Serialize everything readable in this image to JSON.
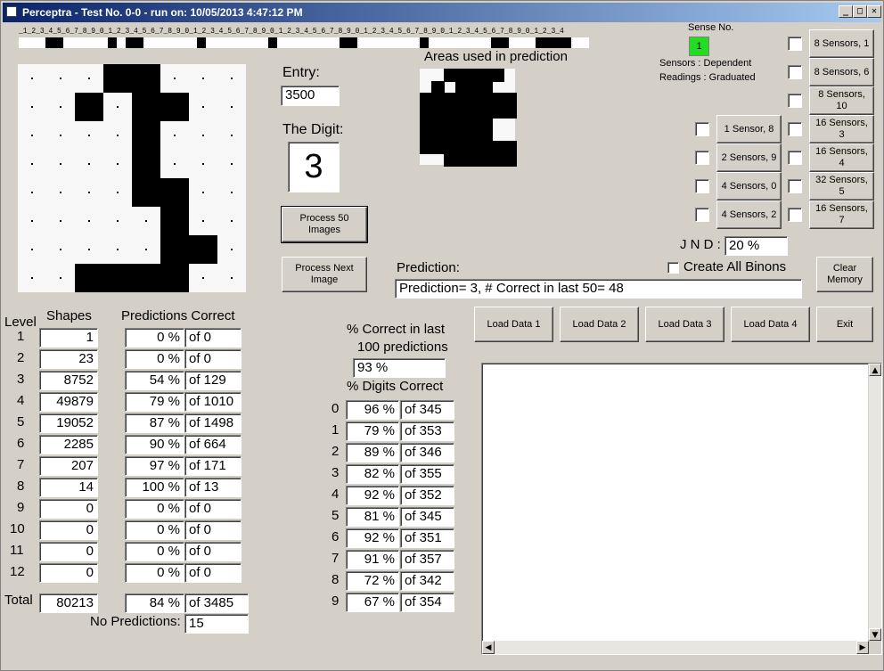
{
  "window": {
    "title": "Perceptra - Test No. 0-0 - run on: 10/05/2013  4:47:12 PM"
  },
  "digit_ruler": {
    "text": "_1_2_3_4_5_6_7_8_9_0_1_2_3_4_5_6_7_8_9_0_1_2_3_4_5_6_7_8_9_0_1_2_3_4_5_6_7_8_9_0_1_2_3_4_5_6_7_8_9_0_1_2_3_4_5_6_7_8_9_0_1_2_3_4"
  },
  "entry": {
    "label": "Entry:",
    "value": "3500"
  },
  "digit": {
    "label": "The Digit:",
    "value": "3"
  },
  "areas_label": "Areas used in prediction",
  "buttons": {
    "process50": "Process 50 Images",
    "process_next": "Process Next Image",
    "clear_memory": "Clear Memory",
    "load1": "Load Data 1",
    "load2": "Load Data 2",
    "load3": "Load Data 3",
    "load4": "Load Data 4",
    "exit": "Exit"
  },
  "sense": {
    "label": "Sense No.",
    "value": "1",
    "sensors_text": "Sensors  :  Dependent",
    "readings_text": "Readings : Graduated"
  },
  "sensor_buttons_right": [
    "8 Sensors, 1",
    "8 Sensors, 6",
    "8 Sensors, 10",
    "16 Sensors, 3",
    "16 Sensors, 4",
    "32 Sensors, 5",
    "16 Sensors, 7"
  ],
  "sensor_buttons_left": [
    "1 Sensor, 8",
    "2 Sensors, 9",
    "4 Sensors, 0",
    "4 Sensors, 2"
  ],
  "jnd": {
    "label": "J N D :",
    "value": "20 %"
  },
  "create_all_binons": "Create All Binons",
  "prediction": {
    "label": "Prediction:",
    "value": "Prediction= 3, # Correct in last 50= 48"
  },
  "levels_table": {
    "headers": {
      "level": "Level",
      "shapes": "Shapes",
      "predictions": "Predictions Correct"
    },
    "rows": [
      {
        "level": "1",
        "shapes": "1",
        "pct": "0 %",
        "of": "of 0"
      },
      {
        "level": "2",
        "shapes": "23",
        "pct": "0 %",
        "of": "of 0"
      },
      {
        "level": "3",
        "shapes": "8752",
        "pct": "54 %",
        "of": "of 129"
      },
      {
        "level": "4",
        "shapes": "49879",
        "pct": "79 %",
        "of": "of 1010"
      },
      {
        "level": "5",
        "shapes": "19052",
        "pct": "87 %",
        "of": "of 1498"
      },
      {
        "level": "6",
        "shapes": "2285",
        "pct": "90 %",
        "of": "of 664"
      },
      {
        "level": "7",
        "shapes": "207",
        "pct": "97 %",
        "of": "of 171"
      },
      {
        "level": "8",
        "shapes": "14",
        "pct": "100 %",
        "of": "of 13"
      },
      {
        "level": "9",
        "shapes": "0",
        "pct": "0 %",
        "of": "of 0"
      },
      {
        "level": "10",
        "shapes": "0",
        "pct": "0 %",
        "of": "of 0"
      },
      {
        "level": "11",
        "shapes": "0",
        "pct": "0 %",
        "of": "of 0"
      },
      {
        "level": "12",
        "shapes": "0",
        "pct": "0 %",
        "of": "of 0"
      }
    ],
    "total": {
      "label": "Total",
      "shapes": "80213",
      "pct": "84 %",
      "of": "of 3485"
    },
    "no_predictions": {
      "label": "No Predictions:",
      "value": "15"
    }
  },
  "last100": {
    "label1": "% Correct in last",
    "label2": "100 predictions",
    "value": "93 %"
  },
  "digits_table": {
    "header": "% Digits Correct",
    "rows": [
      {
        "digit": "0",
        "pct": "96 %",
        "of": "of 345"
      },
      {
        "digit": "1",
        "pct": "79 %",
        "of": "of 353"
      },
      {
        "digit": "2",
        "pct": "89 %",
        "of": "of 346"
      },
      {
        "digit": "3",
        "pct": "82 %",
        "of": "of 355"
      },
      {
        "digit": "4",
        "pct": "92 %",
        "of": "of 352"
      },
      {
        "digit": "5",
        "pct": "81 %",
        "of": "of 345"
      },
      {
        "digit": "6",
        "pct": "92 %",
        "of": "of 351"
      },
      {
        "digit": "7",
        "pct": "91 %",
        "of": "of 357"
      },
      {
        "digit": "8",
        "pct": "72 %",
        "of": "of 342"
      },
      {
        "digit": "9",
        "pct": "67 %",
        "of": "of 354"
      }
    ]
  },
  "colors": {
    "sense_indicator": "#22dd22",
    "title_start": "#0a246a",
    "title_end": "#a6caf0"
  }
}
